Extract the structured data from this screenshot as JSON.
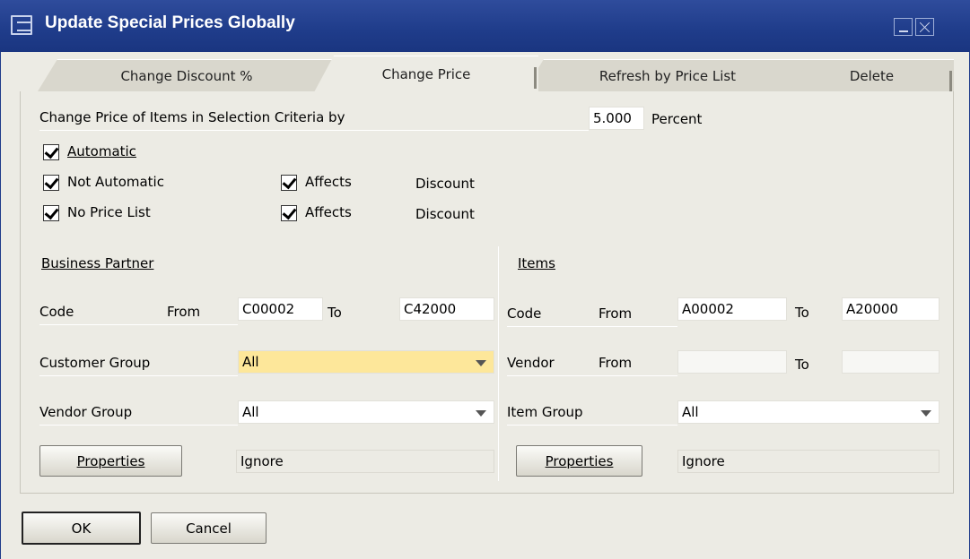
{
  "window": {
    "title": "Update Special Prices Globally"
  },
  "tabs": [
    {
      "label": "Change Discount %"
    },
    {
      "label": "Change Price"
    },
    {
      "label": "Refresh by Price List"
    },
    {
      "label": "Delete"
    }
  ],
  "change_price": {
    "label": "Change Price of Items in Selection Criteria by",
    "value": "5.000",
    "unit": "Percent"
  },
  "checkboxes": {
    "automatic": {
      "label": "Automatic",
      "checked": true
    },
    "not_automatic": {
      "label": "Not Automatic",
      "checked": true
    },
    "no_price_list": {
      "label": "No Price List",
      "checked": true
    },
    "affects_1": {
      "label": "Affects",
      "suffix": "Discount",
      "checked": true
    },
    "affects_2": {
      "label": "Affects",
      "suffix": "Discount",
      "checked": true
    }
  },
  "business_partner": {
    "heading": "Business Partner",
    "code_label": "Code",
    "from_label": "From",
    "code_from": "C00002",
    "to_label": "To",
    "code_to": "C42000",
    "customer_group_label": "Customer Group",
    "customer_group_value": "All",
    "vendor_group_label": "Vendor Group",
    "vendor_group_value": "All",
    "properties_label": "Properties",
    "properties_value": "Ignore"
  },
  "items": {
    "heading": "Items",
    "code_label": "Code",
    "from_label": "From",
    "code_from": "A00002",
    "to_label": "To",
    "code_to": "A20000",
    "vendor_label": "Vendor",
    "vendor_from_label": "From",
    "vendor_to_label": "To",
    "item_group_label": "Item Group",
    "item_group_value": "All",
    "properties_label": "Properties",
    "properties_value": "Ignore"
  },
  "footer": {
    "ok_label": "OK",
    "cancel_label": "Cancel"
  },
  "colors": {
    "titlebar": "#1f3c8a",
    "highlight_field": "#fde79a",
    "background": "#ecebe4"
  }
}
